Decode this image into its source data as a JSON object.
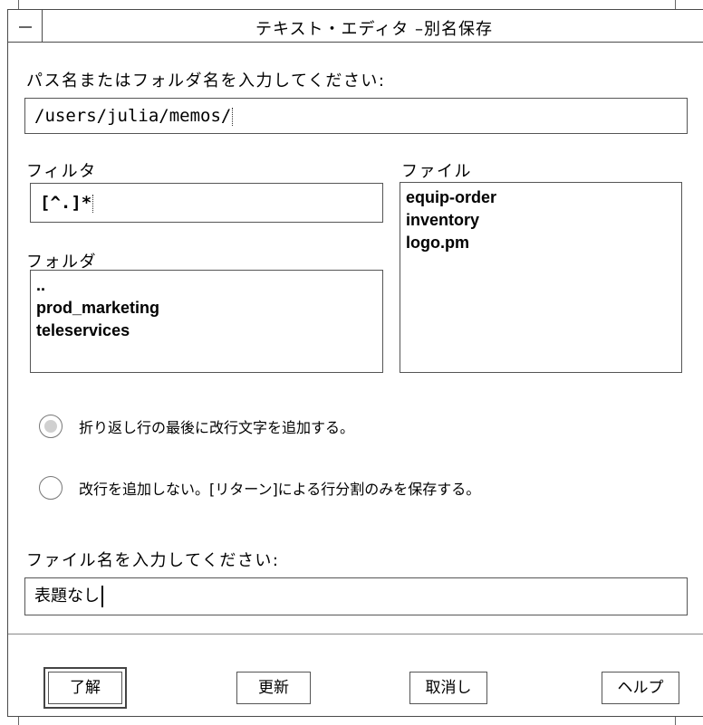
{
  "window": {
    "title": "テキスト・エディタ –別名保存"
  },
  "path": {
    "label": "パス名またはフォルダ名を入力してください:",
    "value": "/users/julia/memos/"
  },
  "filter": {
    "label": "フィルタ",
    "value": "[^.]*"
  },
  "folders": {
    "label": "フォルダ",
    "items": [
      "..",
      "prod_marketing",
      "teleservices"
    ]
  },
  "files": {
    "label": "ファイル",
    "items": [
      "equip-order",
      "inventory",
      "logo.pm"
    ]
  },
  "options": [
    {
      "label": "折り返し行の最後に改行文字を追加する。",
      "selected": true
    },
    {
      "label": "改行を追加しない。[リターン]による行分割のみを保存する。",
      "selected": false
    }
  ],
  "filename": {
    "label": "ファイル名を入力してください:",
    "value": "表題なし"
  },
  "buttons": {
    "ok": "了解",
    "update": "更新",
    "cancel": "取消し",
    "help": "ヘルプ"
  }
}
